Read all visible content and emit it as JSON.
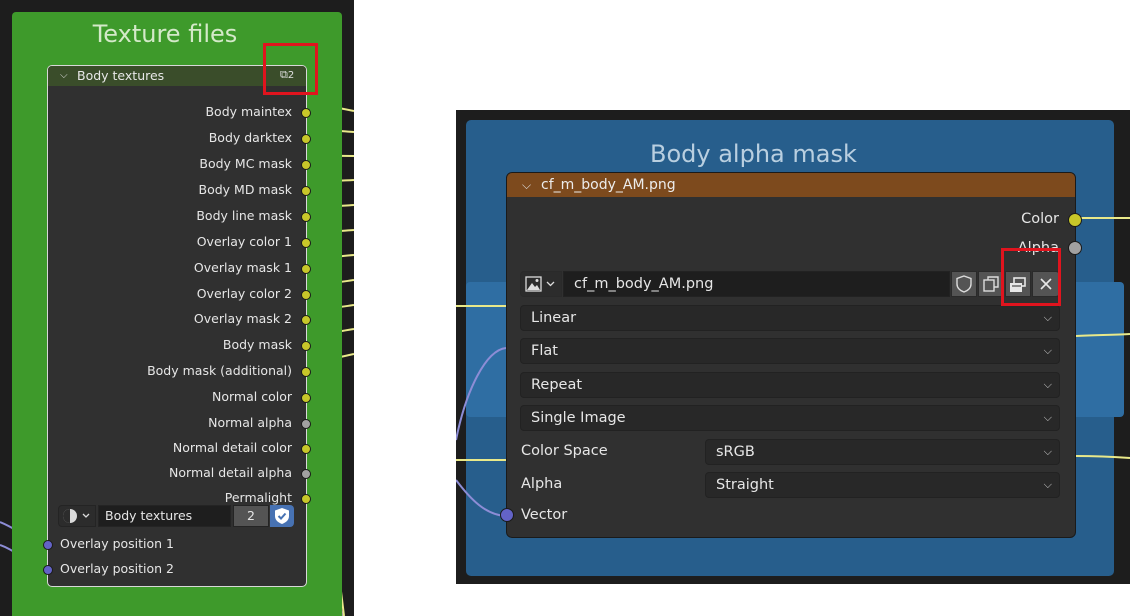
{
  "left": {
    "frame_title": "Texture files",
    "node_header": "Body textures",
    "user_count_badge": "2",
    "outputs": [
      {
        "label": "Body maintex",
        "socket": "yellow"
      },
      {
        "label": "Body darktex",
        "socket": "yellow"
      },
      {
        "label": "Body MC mask",
        "socket": "yellow"
      },
      {
        "label": "Body MD mask",
        "socket": "yellow"
      },
      {
        "label": "Body line mask",
        "socket": "yellow"
      },
      {
        "label": "Overlay color 1",
        "socket": "yellow"
      },
      {
        "label": "Overlay mask 1",
        "socket": "yellow"
      },
      {
        "label": "Overlay color 2",
        "socket": "yellow"
      },
      {
        "label": "Overlay mask 2",
        "socket": "yellow"
      },
      {
        "label": "Body mask",
        "socket": "yellow"
      },
      {
        "label": "Body mask (additional)",
        "socket": "yellow"
      },
      {
        "label": "Normal color",
        "socket": "yellow"
      },
      {
        "label": "Normal alpha",
        "socket": "gray"
      },
      {
        "label": "Normal detail color",
        "socket": "yellow"
      },
      {
        "label": "Normal detail alpha",
        "socket": "gray"
      },
      {
        "label": "Permalight",
        "socket": "yellow"
      }
    ],
    "datablock": {
      "name": "Body textures",
      "users": "2"
    },
    "inputs": [
      {
        "label": "Overlay position 1",
        "socket": "purple"
      },
      {
        "label": "Overlay position 2",
        "socket": "purple"
      }
    ]
  },
  "right": {
    "frame_title": "Body alpha mask",
    "node_header": "cf_m_body_AM.png",
    "outputs": [
      {
        "label": "Color",
        "socket": "yellow"
      },
      {
        "label": "Alpha",
        "socket": "gray"
      }
    ],
    "image_name": "cf_m_body_AM.png",
    "interpolation": "Linear",
    "projection": "Flat",
    "extension": "Repeat",
    "source": "Single Image",
    "color_space_label": "Color Space",
    "color_space_value": "sRGB",
    "alpha_label": "Alpha",
    "alpha_value": "Straight",
    "input_vector": "Vector"
  },
  "colors": {
    "highlight": "#e0141e",
    "socket_yellow": "#c7c729",
    "socket_gray": "#a1a1a1",
    "socket_purple": "#6363c7",
    "frame_green": "#3e9a2b",
    "frame_blue": "#275e8c",
    "image_header": "#7d4a1d"
  },
  "icons": [
    "chevron-down-icon",
    "copy-datablock-icon",
    "image-icon",
    "fake-user-shield-icon",
    "new-image-icon",
    "close-icon",
    "sphere-material-icon"
  ]
}
